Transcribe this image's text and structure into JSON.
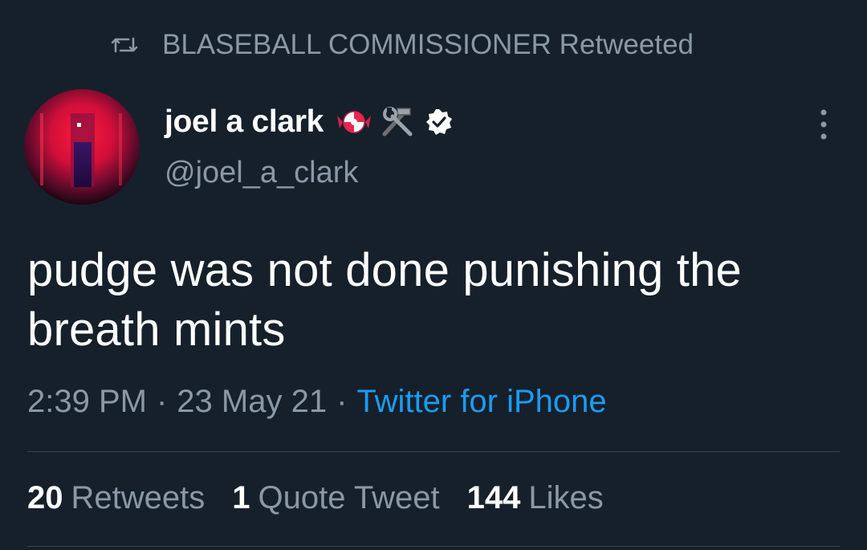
{
  "retweet_context": {
    "icon": "retweet-icon",
    "text": "BLASEBALL COMMISSIONER Retweeted"
  },
  "author": {
    "display_name": "joel a clark",
    "handle": "@joel_a_clark",
    "badges": [
      "candy-emoji",
      "hammer-and-wrench-emoji",
      "verified-badge-icon"
    ]
  },
  "tweet": {
    "text": "pudge was not done punishing the breath mints"
  },
  "meta": {
    "time": "2:39 PM",
    "separator": "·",
    "date": "23 May 21",
    "source": "Twitter for iPhone"
  },
  "stats": {
    "retweets_count": "20",
    "retweets_label": "Retweets",
    "quotes_count": "1",
    "quotes_label": "Quote Tweet",
    "likes_count": "144",
    "likes_label": "Likes"
  },
  "colors": {
    "background": "#15202b",
    "primary_text": "#ffffff",
    "secondary_text": "#8b98a5",
    "link": "#1d9bf0",
    "divider": "#38444d"
  }
}
